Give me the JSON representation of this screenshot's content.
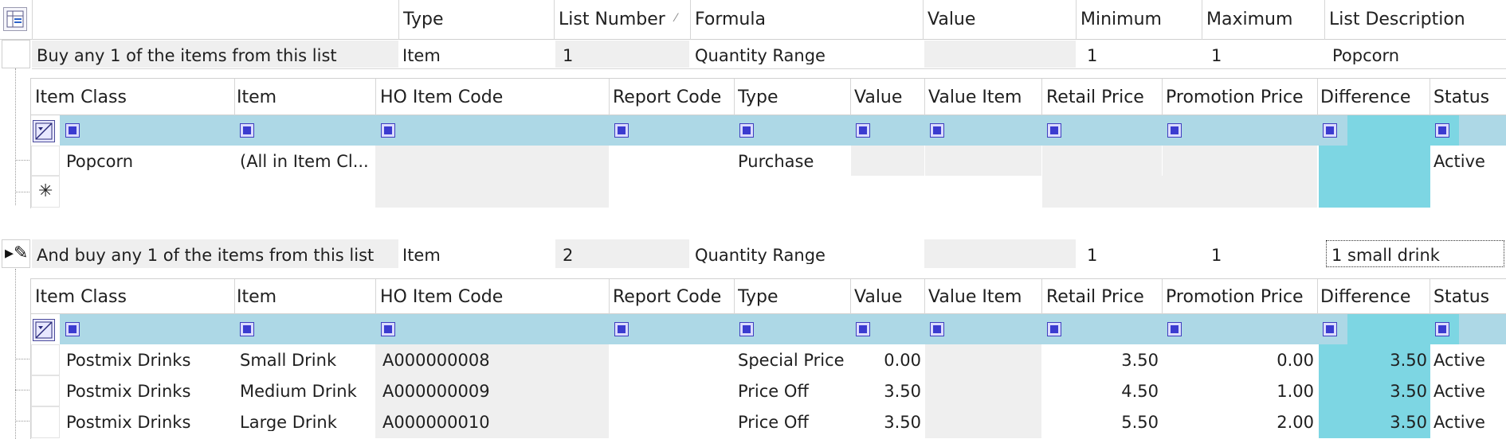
{
  "top": {
    "headers": {
      "type": "Type",
      "list_number": "List Number",
      "formula": "Formula",
      "value": "Value",
      "minimum": "Minimum",
      "maximum": "Maximum",
      "list_description": "List Description"
    },
    "lists": [
      {
        "title": "Buy any 1 of the items from this list",
        "type": "Item",
        "list_number": "1",
        "formula": "Quantity Range",
        "value": "",
        "minimum": "1",
        "maximum": "1",
        "list_description": "Popcorn"
      },
      {
        "title": "And buy any 1 of the items from this list",
        "type": "Item",
        "list_number": "2",
        "formula": "Quantity Range",
        "value": "",
        "minimum": "1",
        "maximum": "1",
        "list_description": "1 small drink"
      }
    ]
  },
  "child_headers": {
    "item_class": "Item Class",
    "item": "Item",
    "ho_item_code": "HO Item Code",
    "report_code": "Report Code",
    "type": "Type",
    "value": "Value",
    "value_item": "Value Item",
    "retail_price": "Retail Price",
    "promotion_price": "Promotion Price",
    "difference": "Difference",
    "status": "Status"
  },
  "grid1_rows": [
    {
      "item_class": "Popcorn",
      "item": "(All in Item Cl...",
      "ho_item_code": "",
      "report_code": "",
      "type": "Purchase",
      "value": "",
      "value_item": "",
      "retail_price": "",
      "promotion_price": "",
      "difference": "",
      "status": "Active"
    }
  ],
  "grid2_rows": [
    {
      "item_class": "Postmix Drinks",
      "item": "Small Drink",
      "ho_item_code": "A000000008",
      "report_code": "",
      "type": "Special Price",
      "value": "0.00",
      "value_item": "",
      "retail_price": "3.50",
      "promotion_price": "0.00",
      "difference": "3.50",
      "status": "Active"
    },
    {
      "item_class": "Postmix Drinks",
      "item": "Medium Drink",
      "ho_item_code": "A000000009",
      "report_code": "",
      "type": "Price Off",
      "value": "3.50",
      "value_item": "",
      "retail_price": "4.50",
      "promotion_price": "1.00",
      "difference": "3.50",
      "status": "Active"
    },
    {
      "item_class": "Postmix Drinks",
      "item": "Large Drink",
      "ho_item_code": "A000000010",
      "report_code": "",
      "type": "Price Off",
      "value": "3.50",
      "value_item": "",
      "retail_price": "5.50",
      "promotion_price": "2.00",
      "difference": "3.50",
      "status": "Active"
    }
  ],
  "icons": {
    "column_chooser": "column-chooser-icon",
    "filter_row": "filter-row-icon",
    "new_row": "asterisk-icon",
    "edit_row": "edit-pencil-icon",
    "sort": "sort-indicator-icon"
  },
  "colors": {
    "filter_band": "#add8e6",
    "difference_column": "#7dd6e3",
    "readonly_cell": "#efefef",
    "filter_square": "#3b3bd0"
  }
}
